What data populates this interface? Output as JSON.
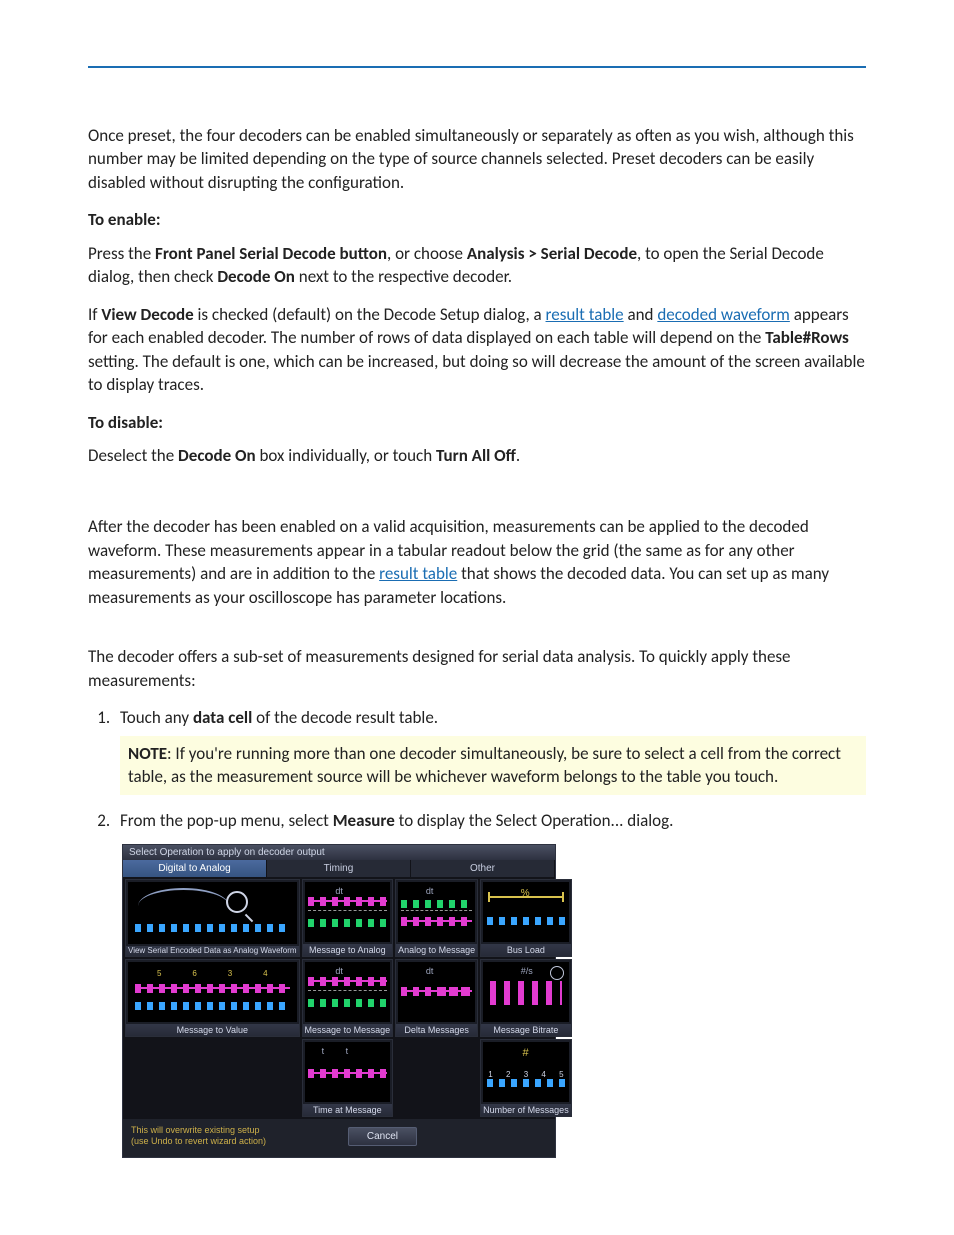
{
  "intro": "Once preset, the four decoders can be enabled simultaneously or separately as often as you wish, although this number may be limited depending on the type of source channels selected. Preset decoders can be easily disabled without disrupting the configuration.",
  "enable_heading": "To enable:",
  "enable_p1_a": "Press the ",
  "enable_p1_b": "Front Panel Serial Decode button",
  "enable_p1_c": ", or choose ",
  "enable_p1_d": "Analysis > Serial Decode",
  "enable_p1_e": ", to open the Serial Decode dialog, then check ",
  "enable_p1_f": "Decode On",
  "enable_p1_g": " next to the respective decoder.",
  "enable_p2_a": "If ",
  "enable_p2_b": "View Decode",
  "enable_p2_c": " is checked (default) on the Decode Setup dialog, a ",
  "link_result_table": "result table",
  "enable_p2_d": " and ",
  "link_decoded_waveform": "decoded waveform",
  "enable_p2_e": " appears for each enabled decoder. The number of rows of data displayed on each table will depend on the ",
  "enable_p2_f": "Table#Rows",
  "enable_p2_g": " setting. The default is one, which can be increased, but doing so will decrease the amount of the screen available to display traces.",
  "disable_heading": "To disable:",
  "disable_p_a": "Deselect the ",
  "disable_p_b": "Decode On",
  "disable_p_c": " box individually, or touch ",
  "disable_p_d": "Turn All Off",
  "disable_p_e": ".",
  "measure_intro_a": "After the decoder has been enabled on a valid acquisition, measurements can be applied to the decoded waveform. These measurements appear in a tabular readout below the grid (the same as for any other measurements) and are in addition to the ",
  "link_result_table2": "result table",
  "measure_intro_b": " that shows the decoded data. You can set up as many measurements as your oscilloscope has parameter locations.",
  "subset_intro": "The decoder offers a sub-set of measurements designed for serial data analysis. To quickly apply these measurements:",
  "step1_a": "Touch any ",
  "step1_b": "data cell",
  "step1_c": " of the decode result table.",
  "note_a": "NOTE",
  "note_b": ": If you're running more than one decoder simultaneously, be sure to select a cell from the correct table, as the measurement source will be whichever waveform belongs to the table you touch.",
  "step2_a": "From the pop-up menu, select ",
  "step2_b": "Measure",
  "step2_c": " to display the Select Operation... dialog.",
  "dialog": {
    "title": "Select Operation to apply on decoder output",
    "tabs": [
      "Digital to Analog",
      "Timing",
      "Other"
    ],
    "cells": [
      {
        "label": "View Serial Encoded Data as Analog Waveform",
        "two": true
      },
      {
        "label": "Message to Analog"
      },
      {
        "label": "Analog to Message"
      },
      {
        "label": "Bus Load"
      },
      {
        "label": "Message to Value"
      },
      {
        "label": "Message to Message"
      },
      {
        "label": "Delta Messages"
      },
      {
        "label": "Message Bitrate"
      },
      {
        "label": "",
        "empty": true
      },
      {
        "label": "Time at Message"
      },
      {
        "label": "",
        "empty": true
      },
      {
        "label": "Number of Messages"
      }
    ],
    "warn1": "This will overwrite existing setup",
    "warn2": "(use Undo to revert wizard action)",
    "cancel": "Cancel"
  }
}
